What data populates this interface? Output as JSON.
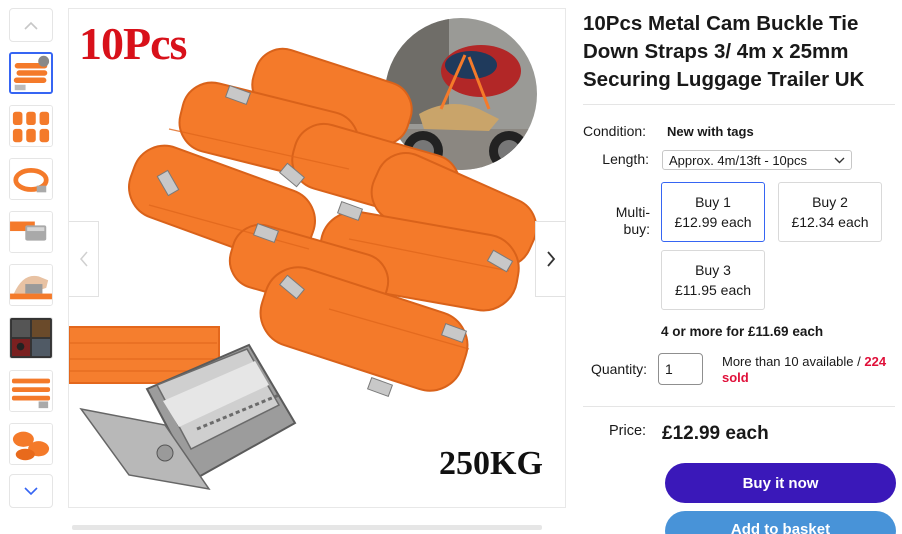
{
  "gallery": {
    "thumbnails": [
      {
        "name": "thumb-straps-bundle",
        "selected": true
      },
      {
        "name": "thumb-straps-grid",
        "selected": false
      },
      {
        "name": "thumb-strap-coil",
        "selected": false
      },
      {
        "name": "thumb-buckle-closeup",
        "selected": false
      },
      {
        "name": "thumb-buckle-hand",
        "selected": false
      },
      {
        "name": "thumb-motorbike",
        "selected": false
      },
      {
        "name": "thumb-strap-length",
        "selected": false
      },
      {
        "name": "thumb-strap-pack",
        "selected": false
      }
    ],
    "main_overlay_quantity": "10Pcs",
    "main_overlay_load": "250KG"
  },
  "listing": {
    "title": "10Pcs Metal Cam Buckle Tie Down Straps 3/ 4m x 25mm Securing Luggage Trailer UK",
    "condition_label": "Condition:",
    "condition_value": "New with tags",
    "length_label": "Length:",
    "length_selected": "Approx. 4m/13ft - 10pcs",
    "multibuy_label": "Multi-\nbuy:",
    "multibuy_tiers": [
      {
        "qty": "Buy 1",
        "price": "£12.99 each",
        "selected": true
      },
      {
        "qty": "Buy 2",
        "price": "£12.34 each",
        "selected": false
      },
      {
        "qty": "Buy 3",
        "price": "£11.95 each",
        "selected": false
      }
    ],
    "multibuy_more": "4 or more for £11.69 each",
    "quantity_label": "Quantity:",
    "quantity_value": "1",
    "availability": "More than 10 available / ",
    "sold": "224 sold",
    "price_label": "Price:",
    "price_value": "£12.99 each",
    "buy_now": "Buy it now",
    "add_to_basket": "Add to basket"
  },
  "colors": {
    "accent_blue": "#3665f3",
    "buy_button": "#3a18b9",
    "basket_button": "#4893d8",
    "sold_red": "#e0103a",
    "strap_orange": "#f47a2a"
  }
}
